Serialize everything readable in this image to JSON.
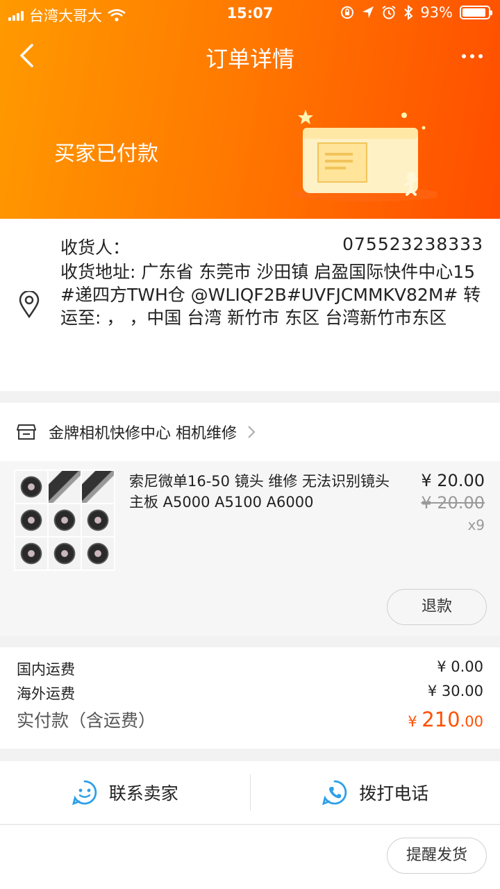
{
  "status_bar": {
    "carrier": "台湾大哥大",
    "time": "15:07",
    "battery_text": "93%",
    "battery_level": 0.93
  },
  "nav": {
    "title": "订单详情"
  },
  "hero": {
    "status": "买家已付款"
  },
  "address": {
    "receiver_label": "收货人：",
    "phone": "075523238333",
    "address_text": "收货地址: 广东省 东莞市 沙田镇 启盈国际快件中心15#递四方TWH仓 @WLIQF2B#UVFJCMMKV82M#  转运至:     ，                       ，中国 台湾 新竹市 东区 台湾新竹市东区"
  },
  "shop": {
    "name": "金牌相机快修中心 相机维修"
  },
  "item": {
    "title": "索尼微单16-50 镜头 维修  无法识别镜头 主板 A5000 A5100 A6000",
    "price": "¥ 20.00",
    "original_price": "¥ 20.00",
    "quantity": "x9",
    "refund_label": "退款"
  },
  "fees": {
    "domestic_label": "国内运费",
    "domestic_value": "¥ 0.00",
    "overseas_label": "海外运费",
    "overseas_value": "¥ 30.00",
    "total_label": "实付款（含运费）",
    "total_currency": "¥ ",
    "total_integer": "210",
    "total_decimal": ".00"
  },
  "actions": {
    "contact_seller": "联系卖家",
    "call_phone": "拨打电话",
    "remind_ship": "提醒发货"
  },
  "colors": {
    "brand_orange": "#ff5000",
    "hero_start": "#ff9a00",
    "accent_blue": "#2da0e8"
  }
}
